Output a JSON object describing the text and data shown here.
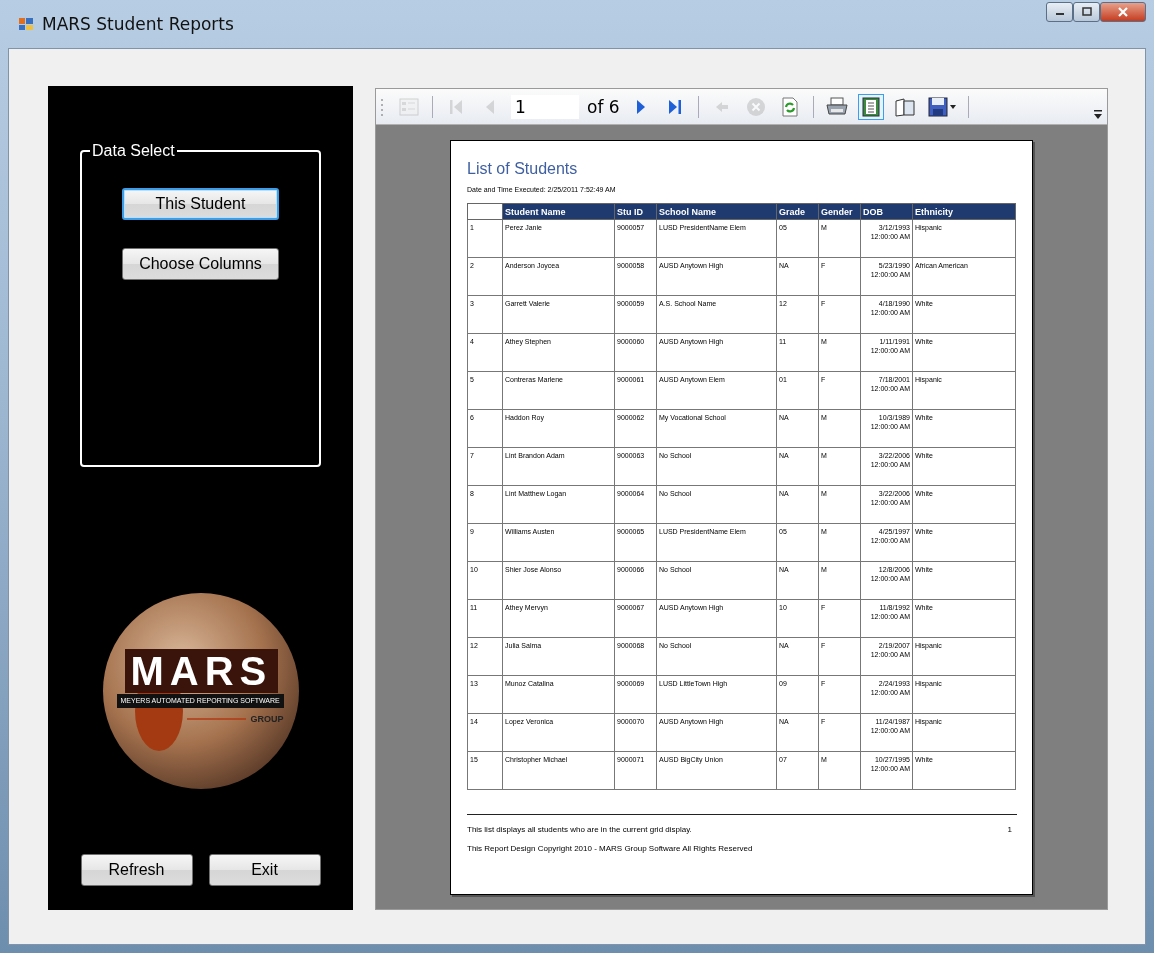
{
  "window": {
    "title": "MARS Student Reports"
  },
  "data_select": {
    "legend": "Data Select",
    "buttons": [
      {
        "label": "This Student",
        "selected": true
      },
      {
        "label": "Choose Columns",
        "selected": false
      }
    ]
  },
  "logo": {
    "title": "MARS",
    "tagline": "MEYERS AUTOMATED REPORTING SOFTWARE",
    "group": "GROUP"
  },
  "bottom_buttons": [
    "Refresh",
    "Exit"
  ],
  "toolbar": {
    "items": [
      {
        "kind": "button",
        "disabled": true,
        "selected": false
      },
      {
        "kind": "separator"
      },
      {
        "kind": "button",
        "disabled": true,
        "selected": false
      },
      {
        "kind": "button",
        "disabled": true,
        "selected": false
      },
      {
        "kind": "page-field",
        "value": "1"
      },
      {
        "kind": "page-count",
        "text": "of 6"
      },
      {
        "kind": "button",
        "disabled": false,
        "selected": false
      },
      {
        "kind": "button",
        "disabled": false,
        "selected": false
      },
      {
        "kind": "separator"
      },
      {
        "kind": "button",
        "disabled": true,
        "selected": false
      },
      {
        "kind": "button",
        "disabled": true,
        "selected": false
      },
      {
        "kind": "button",
        "disabled": false,
        "selected": false
      },
      {
        "kind": "separator"
      },
      {
        "kind": "button",
        "disabled": false,
        "selected": false
      },
      {
        "kind": "button",
        "disabled": false,
        "selected": true
      },
      {
        "kind": "button",
        "disabled": false,
        "selected": false
      },
      {
        "kind": "button",
        "disabled": false,
        "selected": false
      },
      {
        "kind": "separator"
      }
    ]
  },
  "report": {
    "title": "List of Students",
    "executed": "Date and Time Executed: 2/25/2011 7:52:49 AM",
    "columns": [
      "",
      "Student Name",
      "Stu ID",
      "School Name",
      "Grade",
      "Gender",
      "DOB",
      "Ethnicity"
    ],
    "rows": [
      [
        "1",
        "Perez Janie",
        "9000057",
        "LUSD PresidentName Elem",
        "05",
        "M",
        "3/12/1993 12:00:00 AM",
        "Hispanic"
      ],
      [
        "2",
        "Anderson Joycea",
        "9000058",
        "AUSD Anytown High",
        "NA",
        "F",
        "5/23/1990 12:00:00 AM",
        "African American"
      ],
      [
        "3",
        "Garrett Valerie",
        "9000059",
        "A.S. School Name",
        "12",
        "F",
        "4/18/1990 12:00:00 AM",
        "White"
      ],
      [
        "4",
        "Athey Stephen",
        "9000060",
        "AUSD Anytown High",
        "11",
        "M",
        "1/11/1991 12:00:00 AM",
        "White"
      ],
      [
        "5",
        "Contreras Marlene",
        "9000061",
        "AUSD Anytown Elem",
        "01",
        "F",
        "7/18/2001 12:00:00 AM",
        "Hispanic"
      ],
      [
        "6",
        "Haddon Roy",
        "9000062",
        "My Vocational School",
        "NA",
        "M",
        "10/3/1989 12:00:00 AM",
        "White"
      ],
      [
        "7",
        "Lint Brandon Adam",
        "9000063",
        "No School",
        "NA",
        "M",
        "3/22/2006 12:00:00 AM",
        "White"
      ],
      [
        "8",
        "Lint Matthew Logan",
        "9000064",
        "No School",
        "NA",
        "M",
        "3/22/2006 12:00:00 AM",
        "White"
      ],
      [
        "9",
        "Williams Austen",
        "9000065",
        "LUSD PresidentName Elem",
        "05",
        "M",
        "4/25/1997 12:00:00 AM",
        "White"
      ],
      [
        "10",
        "Shier Jose Alonso",
        "9000066",
        "No School",
        "NA",
        "M",
        "12/8/2006 12:00:00 AM",
        "White"
      ],
      [
        "11",
        "Athey Mervyn",
        "9000067",
        "AUSD Anytown High",
        "10",
        "F",
        "11/8/1992 12:00:00 AM",
        "White"
      ],
      [
        "12",
        "Julia Salma",
        "9000068",
        "No School",
        "NA",
        "F",
        "2/19/2007 12:00:00 AM",
        "Hispanic"
      ],
      [
        "13",
        "Munoz Catalina",
        "9000069",
        "LUSD LittleTown High",
        "09",
        "F",
        "2/24/1993 12:00:00 AM",
        "Hispanic"
      ],
      [
        "14",
        "Lopez Veronica",
        "9000070",
        "AUSD Anytown High",
        "NA",
        "F",
        "11/24/1987 12:00:00 AM",
        "Hispanic"
      ],
      [
        "15",
        "Christopher Michael",
        "9000071",
        "AUSD BigCity Union",
        "07",
        "M",
        "10/27/1995 12:00:00 AM",
        "White"
      ]
    ],
    "footer_note": "This list displays all students who are in the current grid display.",
    "page_number": "1",
    "copyright": "This Report Design Copyright 2010 - MARS Group Software All Rights Reserved"
  }
}
